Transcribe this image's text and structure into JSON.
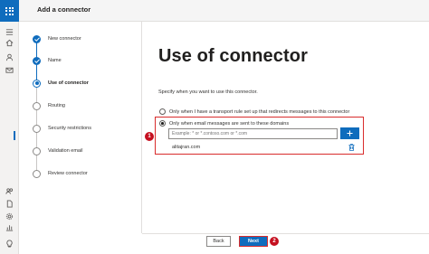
{
  "header": {
    "title": "Add a connector"
  },
  "steps": [
    {
      "label": "New connector",
      "state": "done"
    },
    {
      "label": "Name",
      "state": "done"
    },
    {
      "label": "Use of connector",
      "state": "current"
    },
    {
      "label": "Routing",
      "state": "todo"
    },
    {
      "label": "Security restrictions",
      "state": "todo"
    },
    {
      "label": "Validation email",
      "state": "todo"
    },
    {
      "label": "Review connector",
      "state": "todo"
    }
  ],
  "main": {
    "heading": "Use of connector",
    "description": "Specify when you want to use this connector.",
    "options": [
      {
        "label": "Only when I have a transport rule set up that redirects messages to this connector",
        "checked": false
      },
      {
        "label": "Only when email messages are sent to these domains",
        "checked": true
      }
    ],
    "domain_input": {
      "value": "",
      "placeholder": "Example: * or *.contoso.com or *.com"
    },
    "domains": [
      "alitajran.com"
    ]
  },
  "callouts": {
    "first": "1",
    "second": "2"
  },
  "footer": {
    "back_label": "Back",
    "next_label": "Next"
  },
  "colors": {
    "accent": "#0f6cbd",
    "highlight": "#d92c2c",
    "callout": "#c50f1f"
  },
  "icons": {
    "rail": [
      "app-launcher-icon",
      "home-icon",
      "user-icon",
      "mail-icon",
      "groups-icon",
      "reports-icon",
      "document-icon",
      "settings-icon",
      "chart-icon",
      "lightbulb-icon"
    ],
    "add": "plus-icon",
    "delete": "trash-icon"
  }
}
